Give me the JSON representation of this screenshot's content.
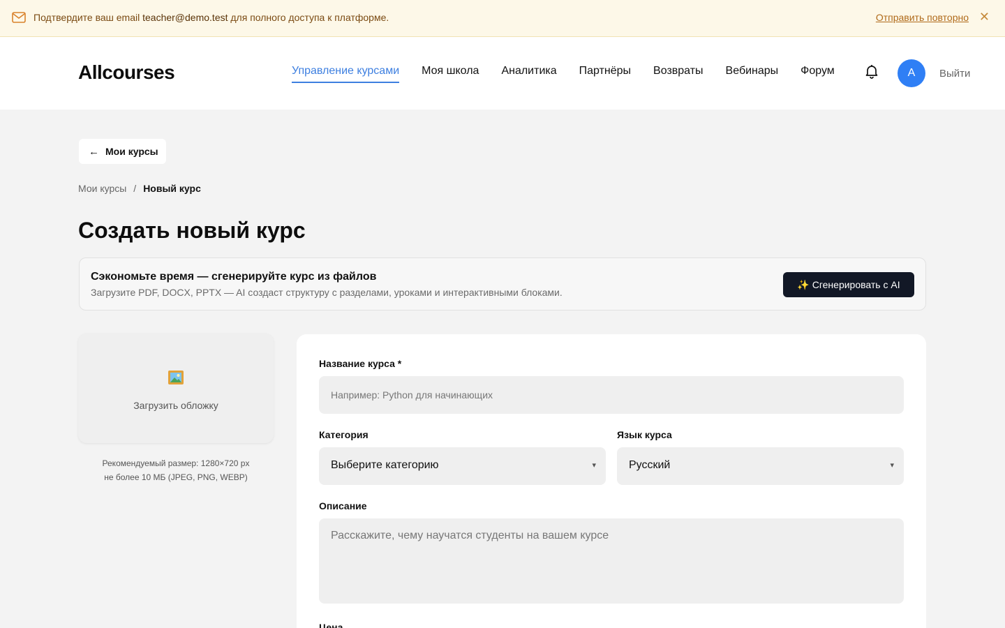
{
  "banner": {
    "text_before": "Подтвердите ваш email ",
    "email": "teacher@demo.test",
    "text_after": " для полного доступа к платформе.",
    "resend_label": "Отправить повторно",
    "close_glyph": "✕",
    "icon": "mail-icon"
  },
  "header": {
    "logo": "Allcourses",
    "nav": [
      {
        "label": "Управление курсами",
        "active": true
      },
      {
        "label": "Моя школа"
      },
      {
        "label": "Аналитика"
      },
      {
        "label": "Партнёры"
      },
      {
        "label": "Возвраты"
      },
      {
        "label": "Вебинары"
      },
      {
        "label": "Форум"
      }
    ],
    "avatar_initial": "A",
    "logout": "Выйти",
    "accent_color": "#3d7fe0"
  },
  "page": {
    "back_label": "Мои курсы",
    "back_glyph": "←",
    "breadcrumb": {
      "parent": "Мои курсы",
      "separator": "/",
      "current": "Новый курс"
    },
    "title": "Создать новый курс"
  },
  "ai_promo": {
    "title": "Сэкономьте время — сгенерируйте курс из файлов",
    "subtitle": "Загрузите PDF, DOCX, PPTX — AI создаст структуру с разделами, уроками и интерактивными блоками.",
    "button_label": "✨ Сгенерировать с AI"
  },
  "cover": {
    "label": "Загрузить обложку",
    "hint_line1": "Рекомендуемый размер: 1280×720 px",
    "hint_line2": "не более 10 МБ (JPEG, PNG, WEBP)",
    "icon": "picture-icon"
  },
  "form": {
    "name_label": "Название курса *",
    "name_placeholder": "Например: Python для начинающих",
    "category_label": "Категория",
    "category_value": "Выберите категорию",
    "language_label": "Язык курса",
    "language_value": "Русский",
    "caret": "▾",
    "description_label": "Описание",
    "description_placeholder": "Расскажите, чему научатся студенты на вашем курсе",
    "price_label": "Цена"
  }
}
